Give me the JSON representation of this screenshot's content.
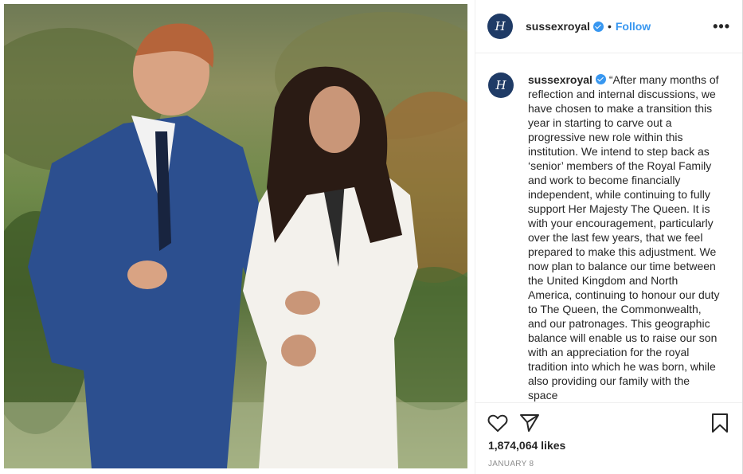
{
  "post": {
    "username": "sussexroyal",
    "follow_label": "Follow",
    "separator": "•",
    "more_label": "•••",
    "avatar_monogram": "H",
    "caption": "“After many months of reflection and internal discussions, we have chosen to make a transition this year in starting to carve out a progressive new role within this institution. We intend to step back as ‘senior’ members of the Royal Family and work to become financially independent, while continuing to fully support Her Majesty The Queen. It is with your encouragement, particularly over the last few years, that we feel prepared to make this adjustment. We now plan to balance our time between the United Kingdom and North America, continuing to honour our duty to The Queen, the Commonwealth, and our patronages. This geographic balance will enable us to raise our son with an appreciation for the royal tradition into which he was born, while also providing our family with the space",
    "likes": "1,874,064 likes",
    "date": "JANUARY 8"
  },
  "icons": {
    "avatar": "royal-monogram-icon",
    "verified": "verified-badge-icon",
    "like": "heart-icon",
    "share": "paper-plane-icon",
    "save": "bookmark-icon",
    "more": "more-options-icon"
  },
  "colors": {
    "link": "#3897f0",
    "text": "#262626",
    "muted": "#8e8e8e",
    "avatar": "#1f3b66"
  }
}
